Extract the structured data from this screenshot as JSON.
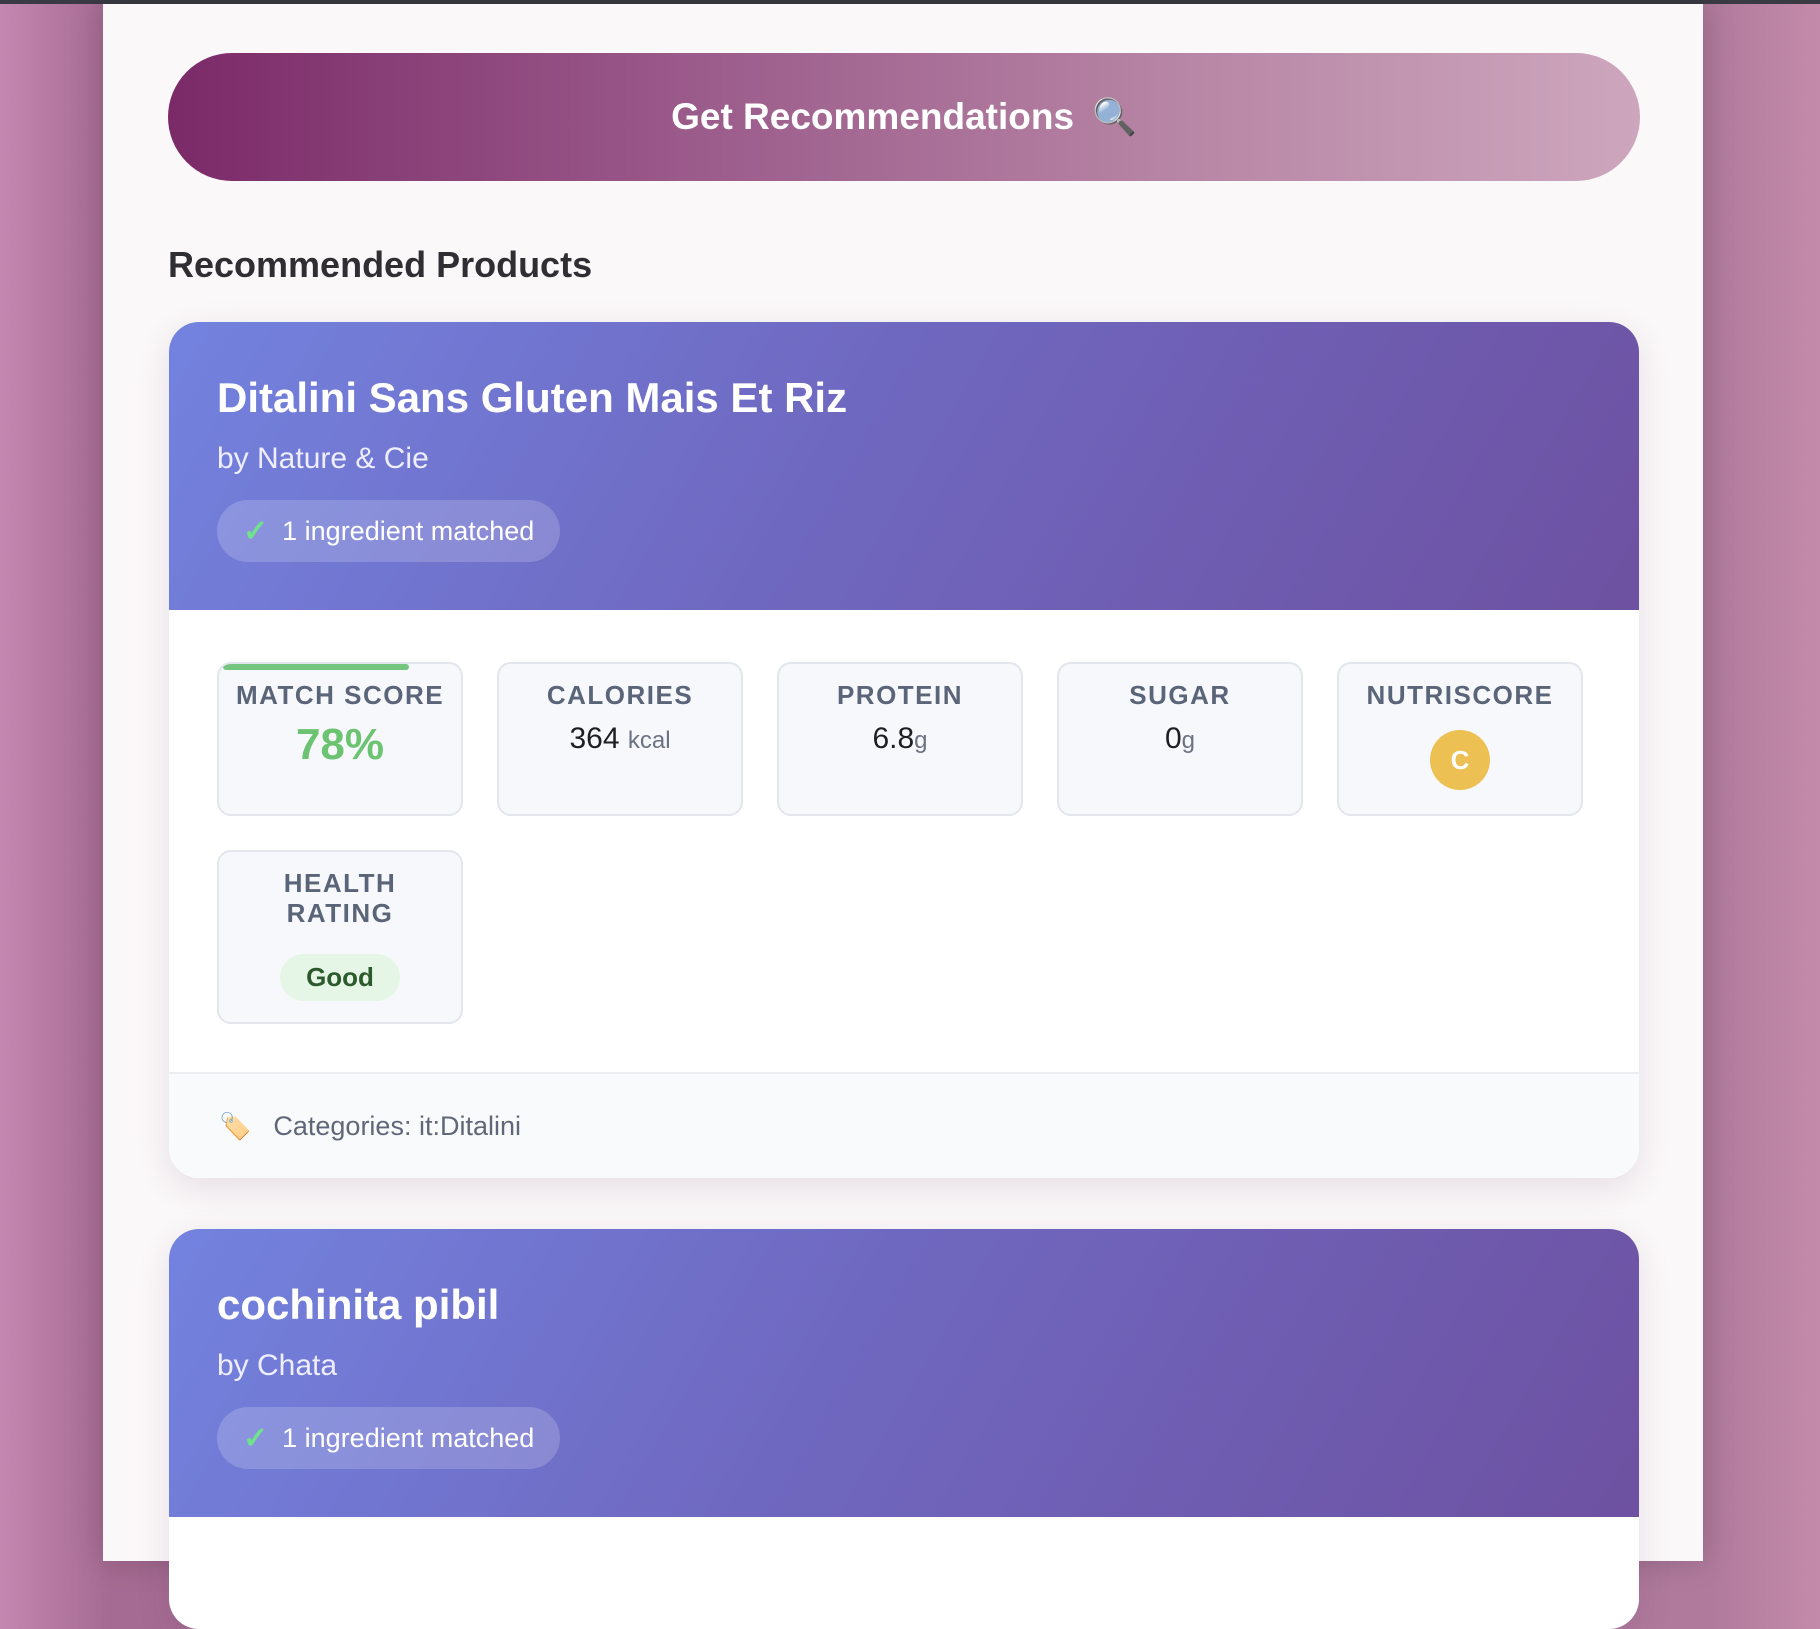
{
  "action": {
    "label": "Get Recommendations",
    "icon": "🔍"
  },
  "section_title": "Recommended Products",
  "products": [
    {
      "name": "Ditalini Sans Gluten Mais Et Riz",
      "brand": "by Nature & Cie",
      "match_badge": "1 ingredient matched",
      "match_label": "MATCH SCORE",
      "match_score": "78%",
      "calories_label": "CALORIES",
      "calories": "364",
      "calories_unit": "kcal",
      "protein_label": "PROTEIN",
      "protein": "6.8",
      "protein_unit": "g",
      "sugar_label": "SUGAR",
      "sugar": "0",
      "sugar_unit": "g",
      "nutriscore_label": "NUTRISCORE",
      "nutriscore": "C",
      "health_label": "HEALTH RATING",
      "health": "Good",
      "categories": "Categories: it:Ditalini",
      "category_icon": "🏷️"
    },
    {
      "name": "cochinita pibil",
      "brand": "by Chata",
      "match_badge": "1 ingredient matched"
    }
  ],
  "check_icon": "✓",
  "colors": {
    "accent": "#7b2a68",
    "card_header": "#6f68c0",
    "score_green": "#6cc472",
    "nutriscore_c": "#ecc052"
  }
}
